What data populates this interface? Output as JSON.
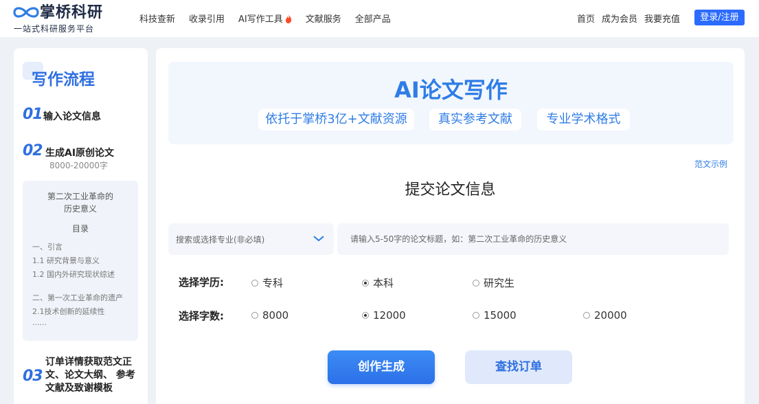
{
  "header": {
    "logo": {
      "title": "掌桥科研",
      "subtitle": "一站式科研服务平台"
    },
    "nav": [
      {
        "label": "科技查新"
      },
      {
        "label": "收录引用"
      },
      {
        "label": "AI写作工具",
        "icon": "fire-icon"
      },
      {
        "label": "文献服务"
      },
      {
        "label": "全部产品"
      }
    ],
    "right_nav": [
      "首页",
      "成为会员",
      "我要充值"
    ],
    "login_label": "登录/注册"
  },
  "sidebar": {
    "title": "写作流程",
    "steps": [
      {
        "num": "01",
        "label": "输入论文信息"
      },
      {
        "num": "02",
        "label": "生成AI原创论文",
        "sub": "8000-20000字"
      },
      {
        "num": "03",
        "label": "订单详情获取范文正文、论文大纲、 参考文献及致谢模板"
      }
    ],
    "sample": {
      "title_line1": "第二次工业革命的",
      "title_line2": "历史意义",
      "toc_label": "目录",
      "lines": [
        "一、引言",
        "1.1 研究背景与意义",
        "1.2 国内外研究现状综述",
        "二、第一次工业革命的遗产",
        "2.1技术创新的延续性",
        "......"
      ]
    }
  },
  "main": {
    "banner": {
      "title": "AI论文写作",
      "pills": [
        "依托于掌桥3亿+文献资源",
        "真实参考文献",
        "专业学术格式"
      ]
    },
    "example_link": "范文示例",
    "form_title": "提交论文信息",
    "major_placeholder": "搜索或选择专业(非必填)",
    "title_placeholder": "请输入5-50字的论文标题，如：第二次工业革命的历史意义",
    "education": {
      "label": "选择学历:",
      "options": [
        "专科",
        "本科",
        "研究生"
      ],
      "selected": "本科"
    },
    "word_count": {
      "label": "选择字数:",
      "options": [
        "8000",
        "12000",
        "15000",
        "20000"
      ],
      "selected": "12000"
    },
    "create_button": "创作生成",
    "order_button": "查找订单"
  },
  "colors": {
    "primary": "#2f6fe0",
    "accent_blue": "#2f7de6",
    "login_bg": "#2b6bff",
    "fire": "#ff4a2b"
  }
}
